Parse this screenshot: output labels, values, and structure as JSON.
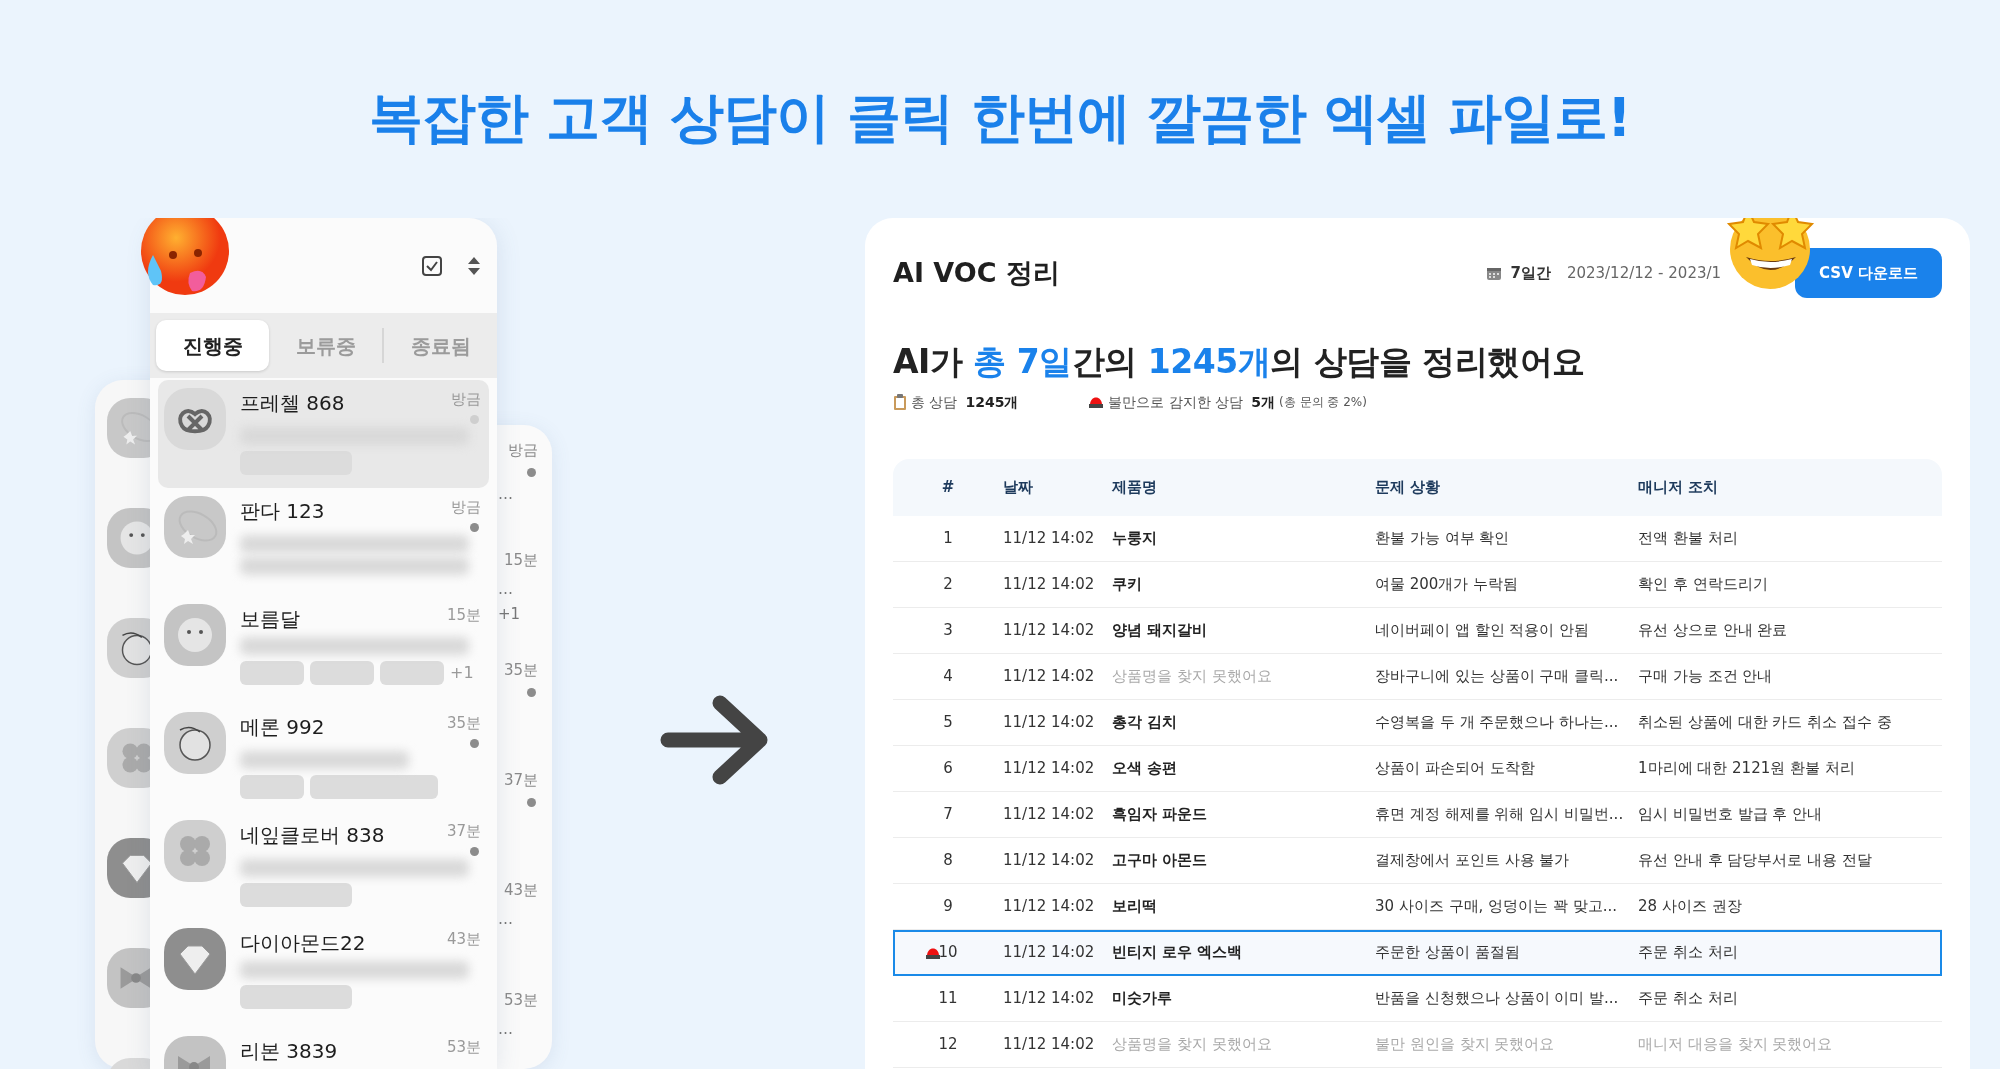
{
  "headline": "복잡한 고객 상담이 클릭 한번에 깔끔한 엑셀 파일로!",
  "chat_app": {
    "tabs": [
      {
        "label": "진행중",
        "selected": true
      },
      {
        "label": "보류중",
        "selected": false
      },
      {
        "label": "종료됨",
        "selected": false
      }
    ],
    "items": [
      {
        "name": "프레첼 868",
        "time": "방금",
        "color": "#cfcfcf",
        "selected": true,
        "preview": [
          {
            "kind": "long"
          }
        ],
        "chips": [
          {
            "kind": "medium"
          }
        ]
      },
      {
        "name": "판다 123",
        "time": "방금",
        "color": "#8c8c8c",
        "selected": false,
        "preview": [
          {
            "kind": "long"
          },
          {
            "kind": "long"
          }
        ]
      },
      {
        "name": "보름달",
        "time": "15분",
        "selected": false,
        "preview": [
          {
            "kind": "long"
          }
        ],
        "chips": [
          {
            "kind": "short"
          },
          {
            "kind": "short"
          },
          {
            "kind": "short"
          }
        ],
        "more": "+1"
      },
      {
        "name": "메론 992",
        "time": "35분",
        "color": "#8c8c8c",
        "selected": false,
        "preview": [
          {
            "kind": "short"
          }
        ],
        "chips": [
          {
            "kind": "short"
          },
          {
            "kind": "long"
          }
        ]
      },
      {
        "name": "네잎클로버 838",
        "time": "37분",
        "color": "#8c8c8c",
        "selected": false,
        "preview": [
          {
            "kind": "long"
          }
        ],
        "chips": [
          {
            "kind": "medium"
          }
        ]
      },
      {
        "name": "다이아몬드22",
        "time": "43분",
        "selected": false,
        "preview": [
          {
            "kind": "long"
          }
        ],
        "chips": [
          {
            "kind": "medium"
          }
        ]
      },
      {
        "name": "리본 3839",
        "time": "53분",
        "selected": false
      }
    ],
    "back_list": [
      {
        "time": "방금",
        "color": "#8c8c8c",
        "extras": [
          "…"
        ]
      },
      {
        "time": "15분",
        "extras": [
          "…",
          "+1"
        ]
      },
      {
        "time": "35분",
        "color": "#8c8c8c"
      },
      {
        "time": "37분",
        "color": "#8c8c8c"
      },
      {
        "time": "43분",
        "extras": [
          "…"
        ]
      },
      {
        "time": "53분",
        "extras": [
          "…"
        ]
      }
    ]
  },
  "voc_report": {
    "title": "AI VOC 정리",
    "period": "7일간",
    "date_range": "2023/12/12 - 2023/1",
    "button": "CSV 다운로드",
    "summary": [
      {
        "text": "AI가 ",
        "highlight": false
      },
      {
        "text": "총 7일",
        "highlight": true
      },
      {
        "text": "간의 ",
        "highlight": false
      },
      {
        "text": "1245개",
        "highlight": true
      },
      {
        "text": "의 상담을 정리했어요",
        "highlight": false
      }
    ],
    "stats": [
      {
        "kind": "total",
        "label": "총 상담",
        "value": "1245개"
      },
      {
        "kind": "complaint",
        "label": "불만으로 감지한 상담",
        "value": "5개",
        "note": "(총 문의 중 2%)"
      }
    ],
    "table": {
      "columns": [
        "#",
        "날짜",
        "제품명",
        "문제 상황",
        "매니저 조치"
      ],
      "rows": [
        {
          "number": "1",
          "date": "11/12 14:02",
          "product": {
            "text": "누룽지",
            "found": true
          },
          "issue": {
            "text": "환불 가능 여부 확인",
            "found": true
          },
          "action": {
            "text": "전액 환불 처리",
            "found": true
          },
          "alert": false,
          "selected": false
        },
        {
          "number": "2",
          "date": "11/12 14:02",
          "product": {
            "text": "쿠키",
            "found": true
          },
          "issue": {
            "text": "여물 200개가 누락됨",
            "found": true
          },
          "action": {
            "text": "확인 후 연락드리기",
            "found": true
          },
          "alert": false,
          "selected": false
        },
        {
          "number": "3",
          "date": "11/12 14:02",
          "product": {
            "text": "양념 돼지갈비",
            "found": true
          },
          "issue": {
            "text": "네이버페이 앱 할인 적용이 안됨",
            "found": true
          },
          "action": {
            "text": "유선 상으로 안내 완료",
            "found": true
          },
          "alert": false,
          "selected": false
        },
        {
          "number": "4",
          "date": "11/12 14:02",
          "product": {
            "text": "상품명을 찾지 못했어요",
            "found": false
          },
          "issue": {
            "text": "장바구니에 있는 상품이 구매 클릭...",
            "found": true
          },
          "action": {
            "text": "구매 가능 조건 안내",
            "found": true
          },
          "alert": false,
          "selected": false
        },
        {
          "number": "5",
          "date": "11/12 14:02",
          "product": {
            "text": "총각 김치",
            "found": true
          },
          "issue": {
            "text": "수영복을 두 개 주문했으나 하나는...",
            "found": true
          },
          "action": {
            "text": "취소된 상품에 대한 카드 취소 접수 중",
            "found": true
          },
          "alert": false,
          "selected": false
        },
        {
          "number": "6",
          "date": "11/12 14:02",
          "product": {
            "text": "오색 송편",
            "found": true
          },
          "issue": {
            "text": "상품이 파손되어 도착함",
            "found": true
          },
          "action": {
            "text": "1마리에 대한 2121원 환불 처리",
            "found": true
          },
          "alert": false,
          "selected": false
        },
        {
          "number": "7",
          "date": "11/12 14:02",
          "product": {
            "text": "흑임자 파운드",
            "found": true
          },
          "issue": {
            "text": "휴면 계정 해제를 위해 임시 비밀번...",
            "found": true
          },
          "action": {
            "text": "임시 비밀번호 발급 후 안내",
            "found": true
          },
          "alert": false,
          "selected": false
        },
        {
          "number": "8",
          "date": "11/12 14:02",
          "product": {
            "text": "고구마 아몬드",
            "found": true
          },
          "issue": {
            "text": "결제창에서 포인트 사용 불가",
            "found": true
          },
          "action": {
            "text": "유선 안내 후 담당부서로 내용 전달",
            "found": true
          },
          "alert": false,
          "selected": false
        },
        {
          "number": "9",
          "date": "11/12 14:02",
          "product": {
            "text": "보리떡",
            "found": true
          },
          "issue": {
            "text": "30 사이즈 구매, 엉덩이는 꽉 맞고...",
            "found": true
          },
          "action": {
            "text": "28 사이즈 권장",
            "found": true
          },
          "alert": false,
          "selected": false
        },
        {
          "number": "10",
          "date": "11/12 14:02",
          "product": {
            "text": "빈티지 로우 엑스백",
            "found": true
          },
          "issue": {
            "text": "주문한 상품이 품절됨",
            "found": true
          },
          "action": {
            "text": "주문 취소 처리",
            "found": true
          },
          "alert": true,
          "selected": true
        },
        {
          "number": "11",
          "date": "11/12 14:02",
          "product": {
            "text": "미숫가루",
            "found": true
          },
          "issue": {
            "text": "반품을 신청했으나 상품이 이미 발...",
            "found": true
          },
          "action": {
            "text": "주문 취소 처리",
            "found": true
          },
          "alert": false,
          "selected": false
        },
        {
          "number": "12",
          "date": "11/12 14:02",
          "product": {
            "text": "상품명을 찾지 못했어요",
            "found": false
          },
          "issue": {
            "text": "불만 원인을 찾지 못했어요",
            "found": false
          },
          "action": {
            "text": "매니저 대응을 찾지 못했어요",
            "found": false
          },
          "alert": false,
          "selected": false
        }
      ]
    }
  }
}
